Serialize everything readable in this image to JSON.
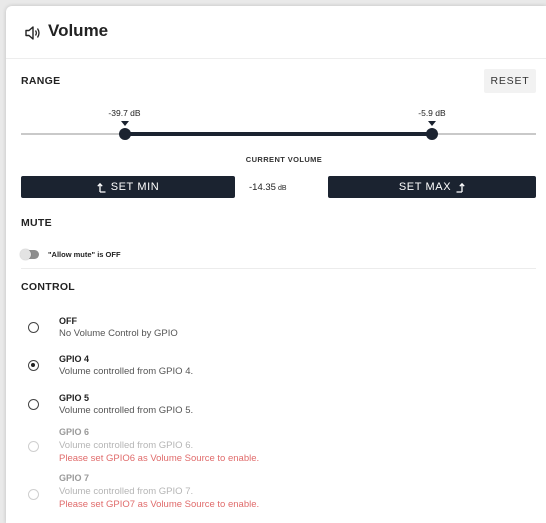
{
  "header": {
    "title": "Volume",
    "icon": "speaker-icon"
  },
  "range": {
    "section_label": "RANGE",
    "reset_label": "RESET",
    "min_value_label": "-39.7 dB",
    "max_value_label": "-5.9 dB",
    "min_position_fraction": 0.201,
    "max_position_fraction": 0.798
  },
  "current_volume": {
    "label": "CURRENT VOLUME",
    "value": "-14.35",
    "unit": "dB",
    "set_min_label": "SET MIN",
    "set_max_label": "SET MAX"
  },
  "mute": {
    "section_label": "MUTE",
    "toggle_label": "\"Allow mute\" is OFF",
    "enabled": false
  },
  "control": {
    "section_label": "CONTROL",
    "options": [
      {
        "title": "OFF",
        "description": "No Volume Control by GPIO",
        "selected": false,
        "disabled": false,
        "warning": ""
      },
      {
        "title": "GPIO 4",
        "description": "Volume controlled from GPIO 4.",
        "selected": true,
        "disabled": false,
        "warning": ""
      },
      {
        "title": "GPIO 5",
        "description": "Volume controlled from GPIO 5.",
        "selected": false,
        "disabled": false,
        "warning": ""
      },
      {
        "title": "GPIO 6",
        "description": "Volume controlled from GPIO 6.",
        "selected": false,
        "disabled": true,
        "warning": "Please set GPIO6 as Volume Source to enable."
      },
      {
        "title": "GPIO 7",
        "description": "Volume controlled from GPIO 7.",
        "selected": false,
        "disabled": true,
        "warning": "Please set GPIO7 as Volume Source to enable."
      }
    ]
  },
  "colors": {
    "dark": "#1b2330",
    "warning": "#e06b6b",
    "track": "#c9c9c9"
  }
}
